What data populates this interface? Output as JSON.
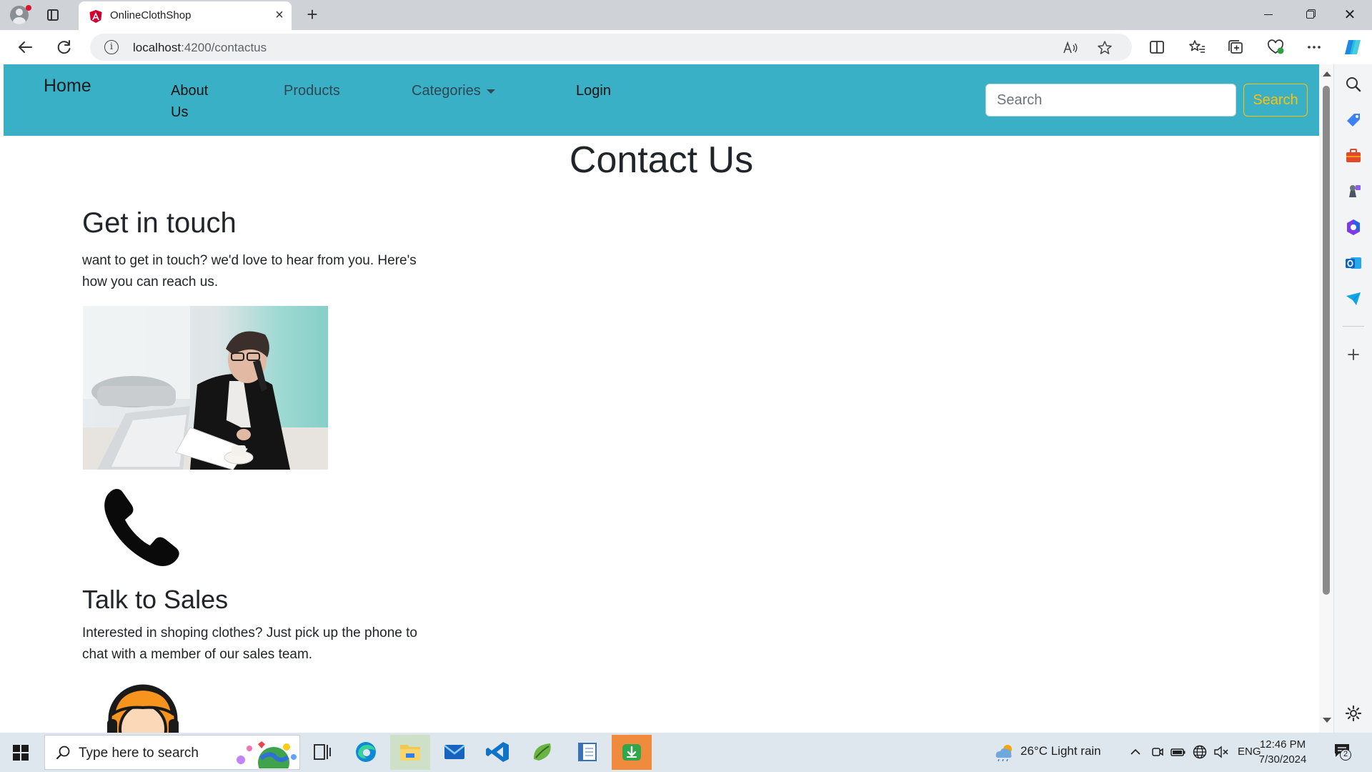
{
  "browser": {
    "tab_title": "OnlineClothShop",
    "tab_close": "×",
    "new_tab": "+",
    "url_host": "localhost",
    "url_rest": ":4200/contactus",
    "info_glyph": "i",
    "win_close": "✕"
  },
  "nav": {
    "brand": "Home",
    "links": [
      "About Us",
      "Products",
      "Categories",
      "Login"
    ],
    "search_placeholder": "Search",
    "search_button": "Search",
    "bg_color": "#39b0c6",
    "accent_color": "#ffc107"
  },
  "page": {
    "title": "Contact Us",
    "touch_heading": "Get in touch",
    "touch_text": "want to get in touch? we'd love to hear from you. Here's how you can reach us.",
    "sales_heading": "Talk to Sales",
    "sales_text": "Interested in shoping clothes? Just pick up the phone to chat with a member of our sales team."
  },
  "taskbar": {
    "search_placeholder": "Type here to search",
    "weather": "26°C  Light rain",
    "lang": "ENG",
    "time": "12:46 PM",
    "date": "7/30/2024",
    "notification_count": "2"
  },
  "icons": {
    "browser": [
      "profile-icon",
      "tab-actions-icon",
      "angular-icon",
      "back-icon",
      "refresh-icon",
      "read-aloud-icon",
      "favorite-icon",
      "split-screen-icon",
      "favorites-icon",
      "collections-icon",
      "browser-essentials-icon",
      "more-icon",
      "copilot-icon"
    ],
    "sidebar": [
      "search-icon",
      "shopping-icon",
      "tools-icon",
      "games-icon",
      "microsoft365-icon",
      "outlook-icon",
      "drop-icon",
      "add-icon",
      "settings-icon"
    ],
    "content": [
      "phone-icon",
      "support-agent-icon"
    ]
  }
}
